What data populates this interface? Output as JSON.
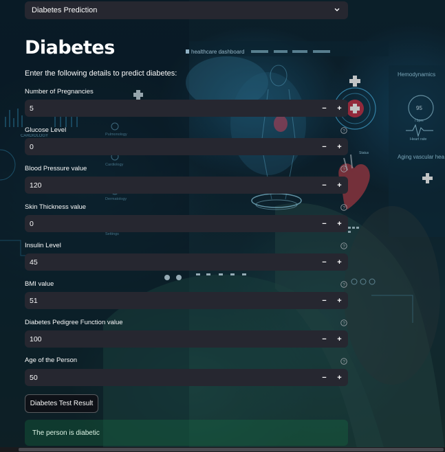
{
  "nav_select": {
    "value": "Diabetes Prediction",
    "icon": "chevron-down-icon"
  },
  "page": {
    "title": "Diabetes",
    "subtitle": "Enter the following details to predict diabetes:"
  },
  "background": {
    "dashboard_label": "healthcare dashboard",
    "cardiology_label": "CARDIOLOGY",
    "pulmonology_label": "Pulmonology",
    "cardiology_menu_label": "Cardiology",
    "dermatology_label": "Dermatology",
    "settings_label": "Settings",
    "hemodynamics_label": "Hemodynamics",
    "bpm_value": "95",
    "bpm_unit": "/ bpm",
    "heart_rate_label": "Heart rate",
    "aging_label": "Aging vascular hea",
    "status_label": "Status"
  },
  "fields": [
    {
      "label": "Number of Pregnancies",
      "value": "5",
      "help": false
    },
    {
      "label": "Glucose Level",
      "value": "0",
      "help": true
    },
    {
      "label": "Blood Pressure value",
      "value": "120",
      "help": true
    },
    {
      "label": "Skin Thickness value",
      "value": "0",
      "help": true
    },
    {
      "label": "Insulin Level",
      "value": "45",
      "help": true
    },
    {
      "label": "BMI value",
      "value": "51",
      "help": true
    },
    {
      "label": "Diabetes Pedigree Function value",
      "value": "100",
      "help": true
    },
    {
      "label": "Age of the Person",
      "value": "50",
      "help": true
    }
  ],
  "stepper": {
    "minus": "−",
    "plus": "+"
  },
  "button": {
    "label": "Diabetes Test Result"
  },
  "result": {
    "text": "The person is diabetic"
  },
  "colors": {
    "widget_bg": "#262730",
    "text": "#fafafa",
    "success_bg": "#177245",
    "accent_red": "#e0334a",
    "hud_blue": "#4fc3f7"
  }
}
